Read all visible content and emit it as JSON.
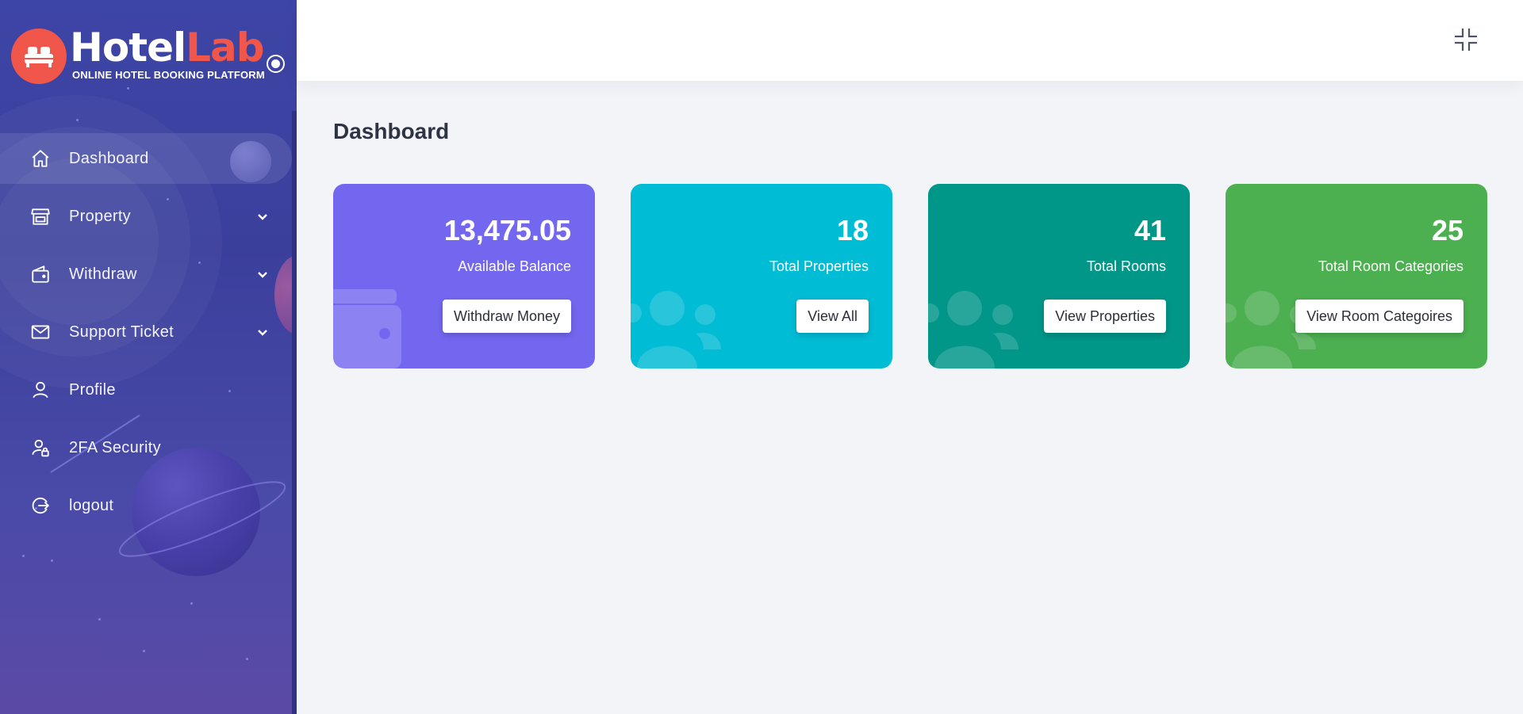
{
  "brand": {
    "name_part1": "Hotel",
    "name_part2": "Lab",
    "tagline": "ONLINE HOTEL BOOKING PLATFORM",
    "accent_color": "#f0564a"
  },
  "sidebar": {
    "items": [
      {
        "label": "Dashboard",
        "icon": "home-icon",
        "active": true,
        "has_submenu": false
      },
      {
        "label": "Property",
        "icon": "store-icon",
        "active": false,
        "has_submenu": true
      },
      {
        "label": "Withdraw",
        "icon": "wallet-icon",
        "active": false,
        "has_submenu": true
      },
      {
        "label": "Support Ticket",
        "icon": "envelope-icon",
        "active": false,
        "has_submenu": true
      },
      {
        "label": "Profile",
        "icon": "user-icon",
        "active": false,
        "has_submenu": false
      },
      {
        "label": "2FA Security",
        "icon": "user-lock-icon",
        "active": false,
        "has_submenu": false
      },
      {
        "label": "logout",
        "icon": "logout-icon",
        "active": false,
        "has_submenu": false
      }
    ]
  },
  "topbar": {
    "fullscreen_icon": "compress-icon"
  },
  "main": {
    "title": "Dashboard",
    "cards": [
      {
        "value": "13,475.05",
        "label": "Available Balance",
        "button": "Withdraw Money",
        "color": "#7367f0",
        "icon": "wallet-icon"
      },
      {
        "value": "18",
        "label": "Total Properties",
        "button": "View All",
        "color": "#00bcd4",
        "icon": "users-icon"
      },
      {
        "value": "41",
        "label": "Total Rooms",
        "button": "View Properties",
        "color": "#009688",
        "icon": "users-icon"
      },
      {
        "value": "25",
        "label": "Total Room Categories",
        "button": "View Room Categoires",
        "color": "#4caf50",
        "icon": "users-icon"
      }
    ]
  }
}
